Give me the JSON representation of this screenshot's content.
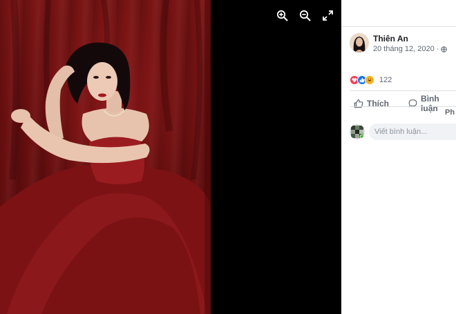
{
  "viewer": {
    "tools": [
      {
        "name": "zoom-in-icon"
      },
      {
        "name": "zoom-out-icon"
      },
      {
        "name": "fullscreen-icon"
      }
    ]
  },
  "post": {
    "author": "Thiên An",
    "date": "20 tháng 12, 2020",
    "separator": "·",
    "privacy_icon": "globe-icon",
    "reactions": {
      "icons": [
        "love-icon",
        "like-icon",
        "haha-icon"
      ],
      "count": "122"
    },
    "actions": {
      "like_label": "Thích",
      "comment_label": "Bình luận"
    },
    "more_text": "Ph",
    "comment_placeholder": "Viết bình luận..."
  },
  "colors": {
    "photo_bg": "#6a0f10",
    "viewer_bg": "#000000",
    "divider": "#dddfe2",
    "secondary_text": "#606770",
    "love": "#f33e58",
    "like": "#1877f2",
    "haha": "#f7b125"
  }
}
